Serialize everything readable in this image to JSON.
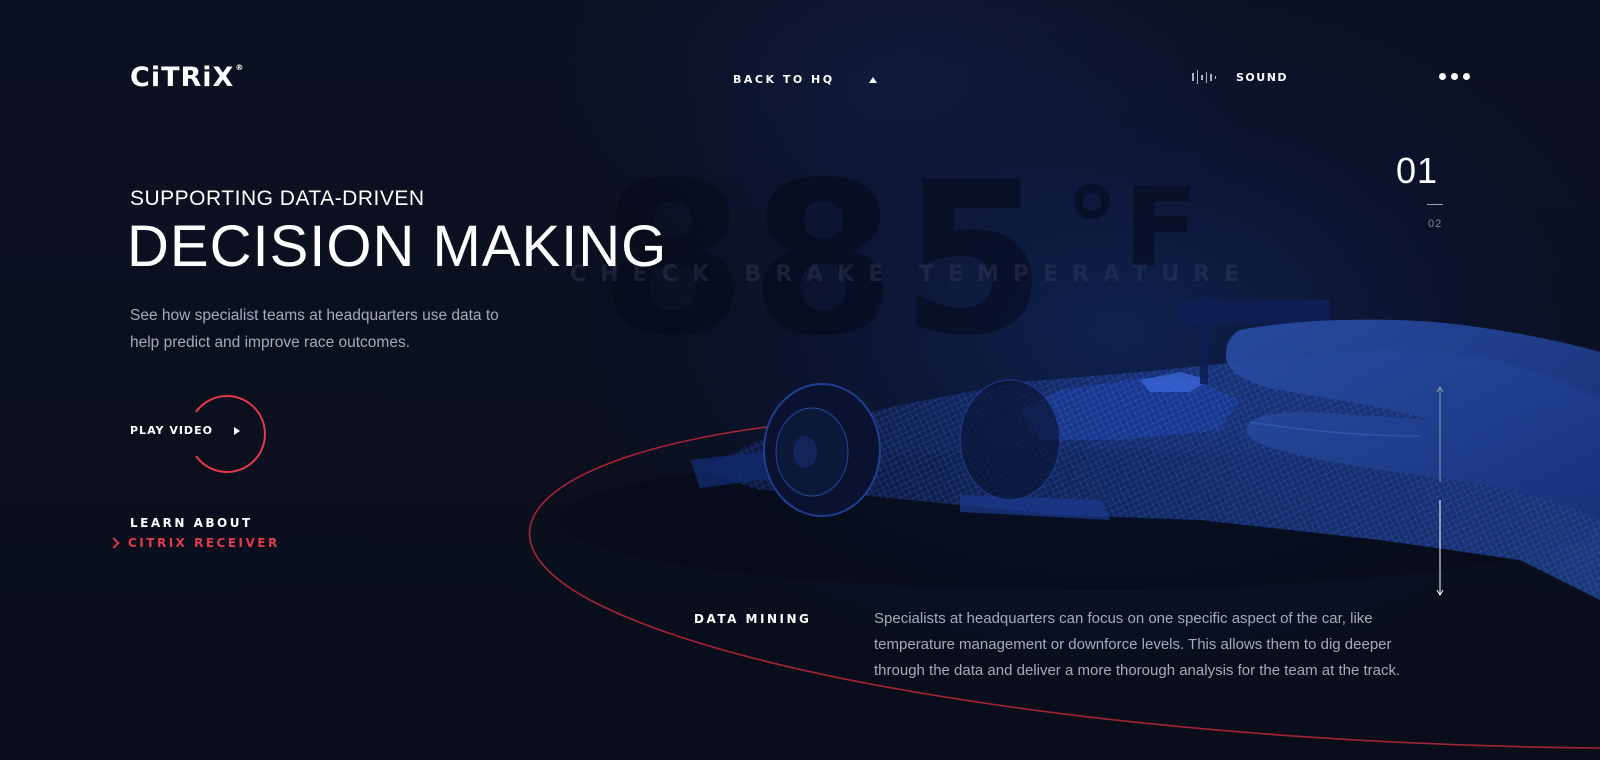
{
  "header": {
    "logo_text": "CiTRiX",
    "logo_mark": "®",
    "back_label": "BACK TO HQ",
    "sound_label": "SOUND"
  },
  "background": {
    "big_number": "885",
    "big_unit": "°F",
    "caption": "CHECK BRAKE TEMPERATURE"
  },
  "hero": {
    "kicker": "SUPPORTING DATA-DRIVEN",
    "title": "DECISION MAKING",
    "description": "See how specialist teams at headquarters use data to help predict and improve race outcomes."
  },
  "play": {
    "label": "PLAY VIDEO"
  },
  "learn": {
    "top": "LEARN ABOUT",
    "link": "CITRIX RECEIVER"
  },
  "counter": {
    "current": "01",
    "next": "02"
  },
  "data_mining": {
    "label": "DATA MINING",
    "text": "Specialists at headquarters can focus on one specific aspect of the car, like temperature management or downforce levels. This allows them to dig deeper through the data and deliver a more thorough analysis for the team at the track."
  },
  "colors": {
    "accent": "#e23a4a",
    "background": "#0b0f1d",
    "wireframe": "#2a55c8"
  },
  "icons": {
    "sound": "sound-wave-icon",
    "menu": "more-dots-icon",
    "back": "caret-up-icon",
    "play": "play-icon"
  }
}
